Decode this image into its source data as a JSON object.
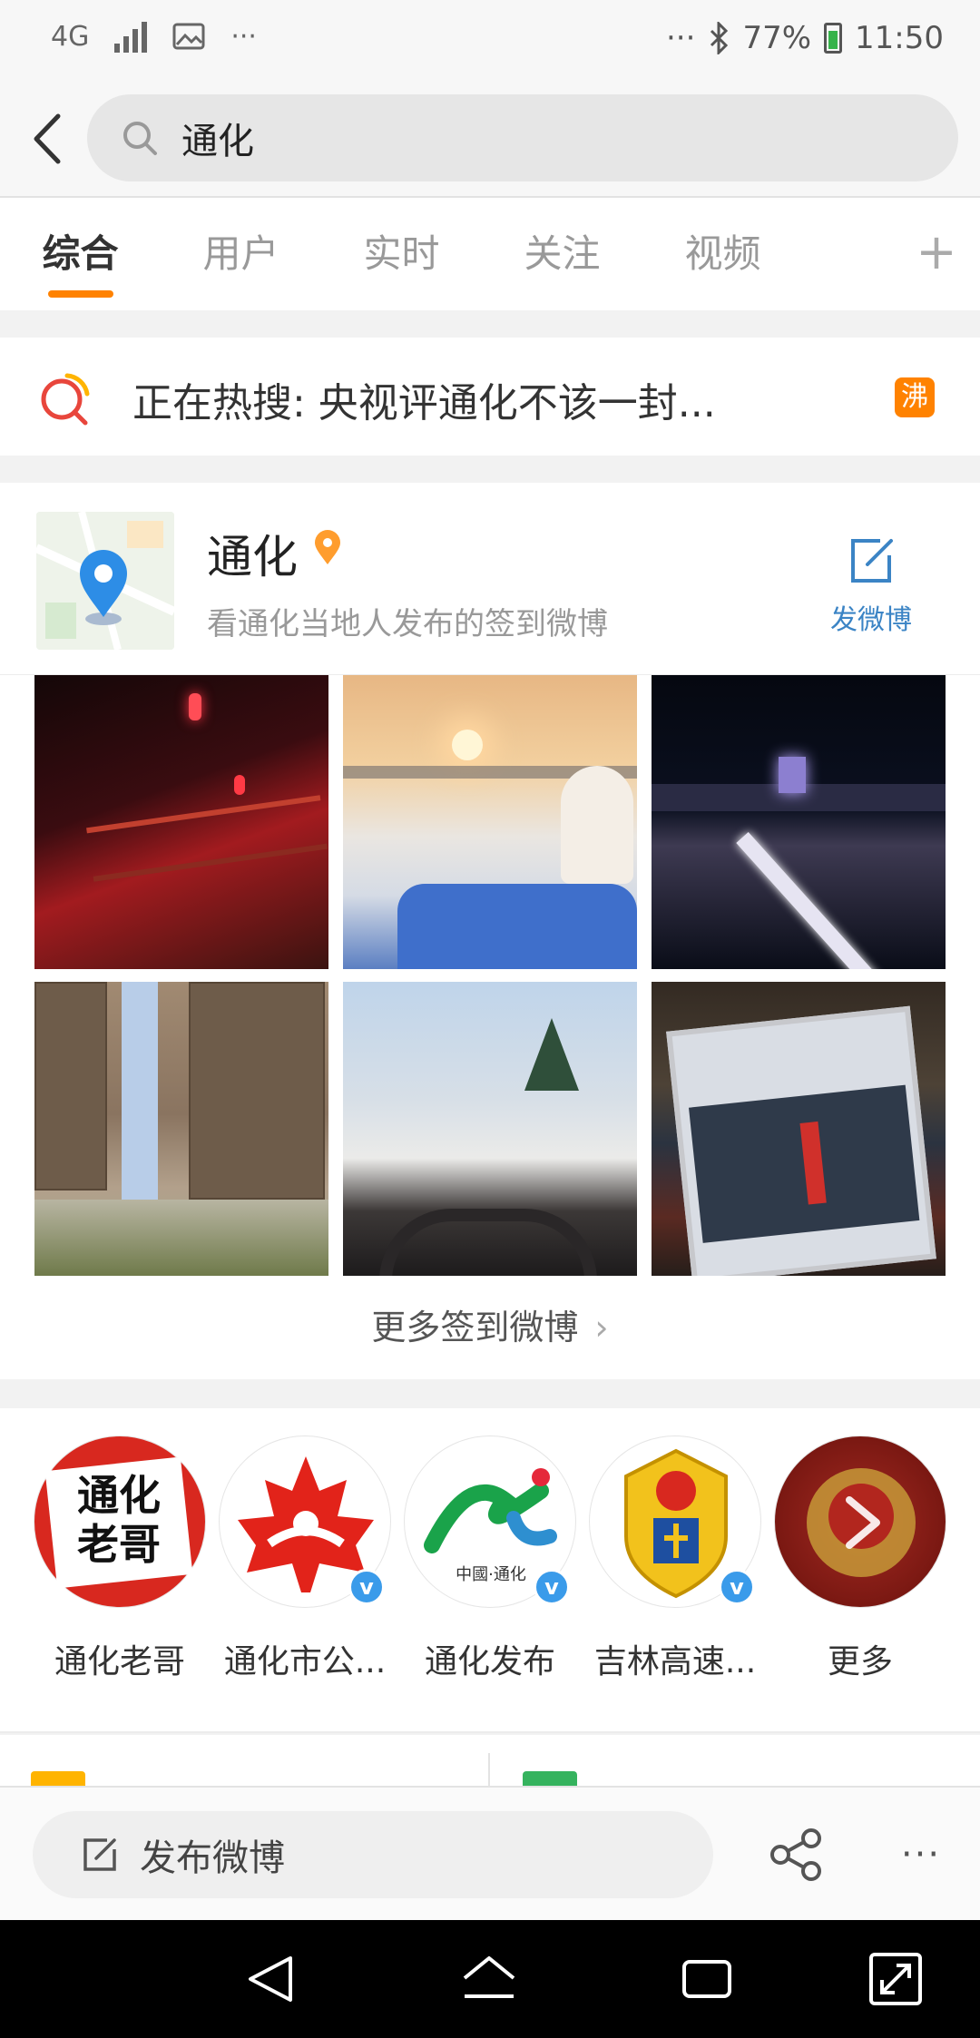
{
  "status_bar": {
    "network": "4G",
    "battery": "77%",
    "time": "11:50",
    "dots_left": "···",
    "dots_right": "···"
  },
  "search": {
    "query": "通化"
  },
  "tabs": [
    {
      "label": "综合",
      "active": true
    },
    {
      "label": "用户",
      "active": false
    },
    {
      "label": "实时",
      "active": false
    },
    {
      "label": "关注",
      "active": false
    },
    {
      "label": "视频",
      "active": false
    }
  ],
  "hot_search": {
    "text": "正在热搜: 央视评通化不该一封...",
    "badge": "沸"
  },
  "location": {
    "title": "通化",
    "subtitle": "看通化当地人发布的签到微博",
    "post_label": "发微博",
    "more_checkins": "更多签到微博"
  },
  "photos": [
    {
      "name": "red-lantern-bridge-photo"
    },
    {
      "name": "snow-sunset-photo"
    },
    {
      "name": "night-bridge-city-photo"
    },
    {
      "name": "residential-towers-photo"
    },
    {
      "name": "car-windshield-winter-photo"
    },
    {
      "name": "tablet-tv-screen-photo"
    }
  ],
  "accounts": [
    {
      "name": "通化老哥",
      "avatar_text": "通化老哥",
      "verified": false
    },
    {
      "name": "通化市公...",
      "avatar_text": "",
      "verified": true
    },
    {
      "name": "通化发布",
      "avatar_text": "中國·通化",
      "verified": true
    },
    {
      "name": "吉林高速...",
      "avatar_text": "",
      "verified": true
    },
    {
      "name": "更多",
      "avatar_text": "",
      "verified": false
    }
  ],
  "compose": {
    "label": "发布微博",
    "more": "···"
  },
  "colors": {
    "accent": "#ff8200",
    "link_blue": "#3b84c5",
    "verified_blue": "#3a9bea"
  }
}
